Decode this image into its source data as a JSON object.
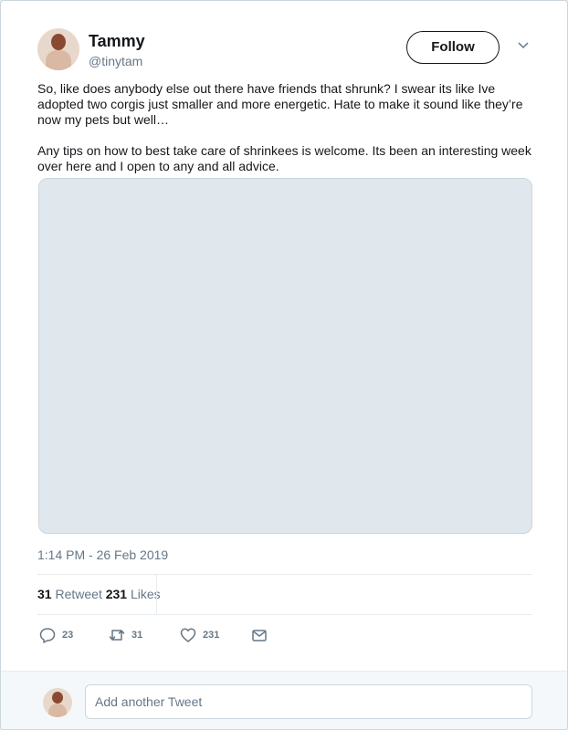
{
  "user": {
    "name": "Tammy",
    "handle": "@tinytam"
  },
  "follow_label": "Follow",
  "tweet_text": "So, like does anybody else out there have friends that shrunk? I swear its like Ive adopted two corgis just smaller and more energetic. Hate to make it sound like they’re now my pets but well…\n\nAny tips on how to best take care of shrinkees is welcome. Its been an interesting week over here and I open to any and all advice.",
  "timestamp": "1:14 PM - 26 Feb 2019",
  "stats": {
    "retweets": "31",
    "retweet_label": "Retweet",
    "likes": "231",
    "likes_label": "Likes"
  },
  "actions": {
    "reply_count": "23",
    "retweet_count": "31",
    "like_count": "231"
  },
  "reply_placeholder": "Add another Tweet",
  "icons": [
    "avatar",
    "chevron-down-icon",
    "reply-icon",
    "retweet-icon",
    "heart-icon",
    "mail-icon"
  ],
  "colors": {
    "text": "#14171a",
    "secondary": "#657786",
    "border": "#ccd6dd",
    "footer_bg": "#f5f8fa"
  }
}
